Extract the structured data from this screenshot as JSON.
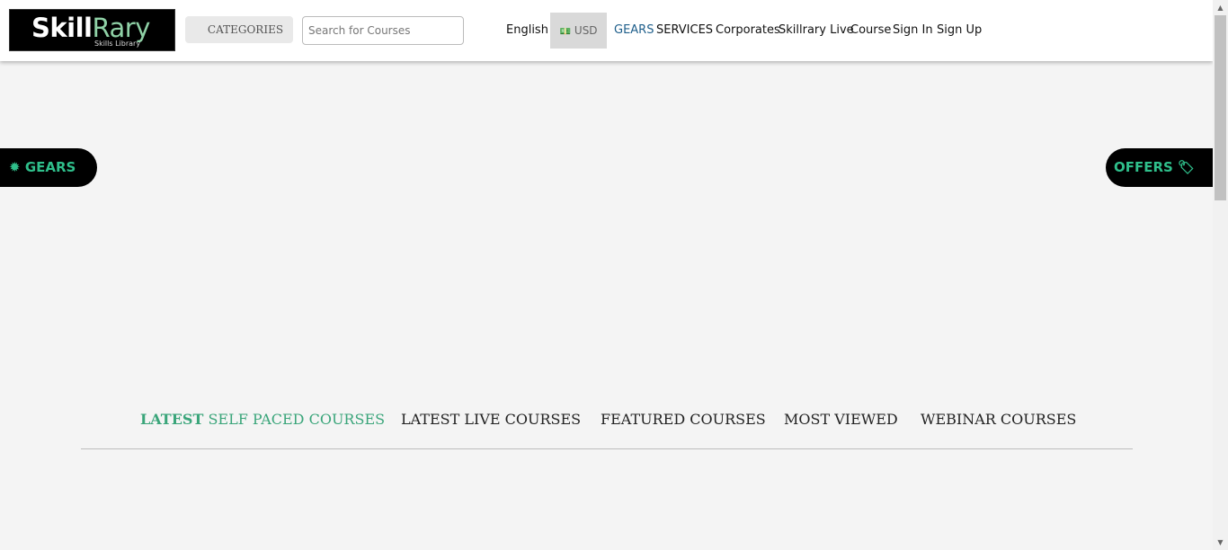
{
  "brand": {
    "logo_main": "Skill",
    "logo_accent": "Rary",
    "logo_sub": "Skills Library"
  },
  "header": {
    "categories_label": "CATEGORIES",
    "search_placeholder": "Search for Courses",
    "language": "English",
    "currency_icon": "money-icon",
    "currency": "USD",
    "nav": {
      "gears": "GEARS",
      "services": "SERVICES",
      "corporates": "Corporates",
      "live": "Skillrary Live",
      "course": "Course",
      "signin": "Sign In",
      "signup": "Sign Up"
    }
  },
  "side_buttons": {
    "gears": "GEARS",
    "offers": "OFFERS"
  },
  "tabs": {
    "latest_bold": "LATEST",
    "latest_rest": " SELF PACED COURSES",
    "live": "LATEST LIVE COURSES",
    "featured": "FEATURED COURSES",
    "most_viewed": "MOST VIEWED",
    "webinar": "WEBINAR COURSES"
  },
  "colors": {
    "accent_green": "#3aa57a",
    "gears_link": "#1f5f8b",
    "pill_bg": "#000000"
  }
}
